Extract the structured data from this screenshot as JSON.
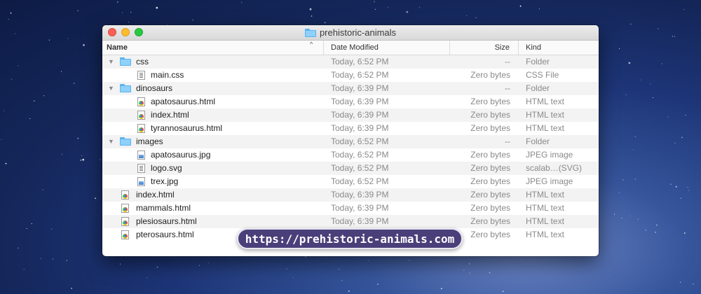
{
  "window": {
    "title": "prehistoric-animals",
    "traffic_lights": {
      "close": "#fc5f57",
      "minimize": "#fdbc2e",
      "maximize": "#28c840"
    }
  },
  "columns": {
    "name": "Name",
    "date": "Date Modified",
    "size": "Size",
    "kind": "Kind",
    "sort_indicator": "^"
  },
  "rows": [
    {
      "name": "css",
      "type": "folder",
      "level": 0,
      "expanded": true,
      "date": "Today, 6:52 PM",
      "size": "--",
      "kind": "Folder"
    },
    {
      "name": "main.css",
      "type": "text",
      "level": 1,
      "date": "Today, 6:52 PM",
      "size": "Zero bytes",
      "kind": "CSS File"
    },
    {
      "name": "dinosaurs",
      "type": "folder",
      "level": 0,
      "expanded": true,
      "date": "Today, 6:39 PM",
      "size": "--",
      "kind": "Folder"
    },
    {
      "name": "apatosaurus.html",
      "type": "html",
      "level": 1,
      "date": "Today, 6:39 PM",
      "size": "Zero bytes",
      "kind": "HTML text"
    },
    {
      "name": "index.html",
      "type": "html",
      "level": 1,
      "date": "Today, 6:39 PM",
      "size": "Zero bytes",
      "kind": "HTML text"
    },
    {
      "name": "tyrannosaurus.html",
      "type": "html",
      "level": 1,
      "date": "Today, 6:39 PM",
      "size": "Zero bytes",
      "kind": "HTML text"
    },
    {
      "name": "images",
      "type": "folder",
      "level": 0,
      "expanded": true,
      "date": "Today, 6:52 PM",
      "size": "--",
      "kind": "Folder"
    },
    {
      "name": "apatosaurus.jpg",
      "type": "image",
      "level": 1,
      "date": "Today, 6:52 PM",
      "size": "Zero bytes",
      "kind": "JPEG image"
    },
    {
      "name": "logo.svg",
      "type": "text",
      "level": 1,
      "date": "Today, 6:52 PM",
      "size": "Zero bytes",
      "kind": "scalab…(SVG)"
    },
    {
      "name": "trex.jpg",
      "type": "image",
      "level": 1,
      "date": "Today, 6:52 PM",
      "size": "Zero bytes",
      "kind": "JPEG image"
    },
    {
      "name": "index.html",
      "type": "html",
      "level": 0,
      "date": "Today, 6:39 PM",
      "size": "Zero bytes",
      "kind": "HTML text"
    },
    {
      "name": "mammals.html",
      "type": "html",
      "level": 0,
      "date": "Today, 6:39 PM",
      "size": "Zero bytes",
      "kind": "HTML text"
    },
    {
      "name": "plesiosaurs.html",
      "type": "html",
      "level": 0,
      "date": "Today, 6:39 PM",
      "size": "Zero bytes",
      "kind": "HTML text"
    },
    {
      "name": "pterosaurs.html",
      "type": "html",
      "level": 0,
      "date": "Today, 6:39 PM",
      "size": "Zero bytes",
      "kind": "HTML text"
    }
  ],
  "overlay": {
    "url": "https://prehistoric-animals.com"
  }
}
